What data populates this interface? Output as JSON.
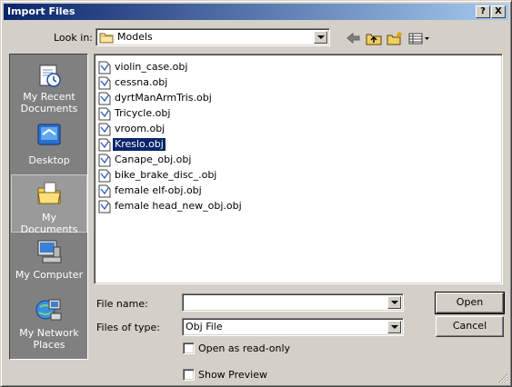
{
  "window": {
    "title": "Import Files",
    "help_glyph": "?",
    "close_glyph": "X"
  },
  "toolbar": {
    "look_in_label": "Look in:",
    "look_in_value": "Models",
    "icons": [
      "back-arrow-icon",
      "up-folder-icon",
      "new-folder-icon",
      "view-menu-icon"
    ]
  },
  "places": [
    {
      "label": "My Recent Documents",
      "line1": "My Recent",
      "line2": "Documents",
      "icon": "recent-documents-icon",
      "selected": false
    },
    {
      "label": "Desktop",
      "line1": "Desktop",
      "line2": "",
      "icon": "desktop-icon",
      "selected": false
    },
    {
      "label": "My Documents",
      "line1": "My Documents",
      "line2": "",
      "icon": "my-documents-icon",
      "selected": true
    },
    {
      "label": "My Computer",
      "line1": "My Computer",
      "line2": "",
      "icon": "my-computer-icon",
      "selected": false
    },
    {
      "label": "My Network Places",
      "line1": "My Network",
      "line2": "Places",
      "icon": "network-places-icon",
      "selected": false
    }
  ],
  "files": [
    {
      "name": "violin_case.obj",
      "selected": false
    },
    {
      "name": "cessna.obj",
      "selected": false
    },
    {
      "name": "dyrtManArmTris.obj",
      "selected": false
    },
    {
      "name": "Tricycle.obj",
      "selected": false
    },
    {
      "name": "vroom.obj",
      "selected": false
    },
    {
      "name": "Kreslo.obj",
      "selected": true
    },
    {
      "name": "Canape_obj.obj",
      "selected": false
    },
    {
      "name": "bike_brake_disc_.obj",
      "selected": false
    },
    {
      "name": "female elf-obj.obj",
      "selected": false
    },
    {
      "name": "female head_new_obj.obj",
      "selected": false
    }
  ],
  "form": {
    "file_name_label": "File name:",
    "file_name_value": "",
    "files_of_type_label": "Files of type:",
    "files_of_type_value": "Obj File",
    "read_only_label": "Open as read-only",
    "read_only_checked": false,
    "show_preview_label": "Show Preview",
    "show_preview_checked": false
  },
  "buttons": {
    "open": "Open",
    "cancel": "Cancel"
  },
  "colors": {
    "title_start": "#0a246a",
    "title_end": "#a6caf0",
    "selection": "#0a246a",
    "face": "#d4d0c8",
    "places_bg": "#808080"
  }
}
